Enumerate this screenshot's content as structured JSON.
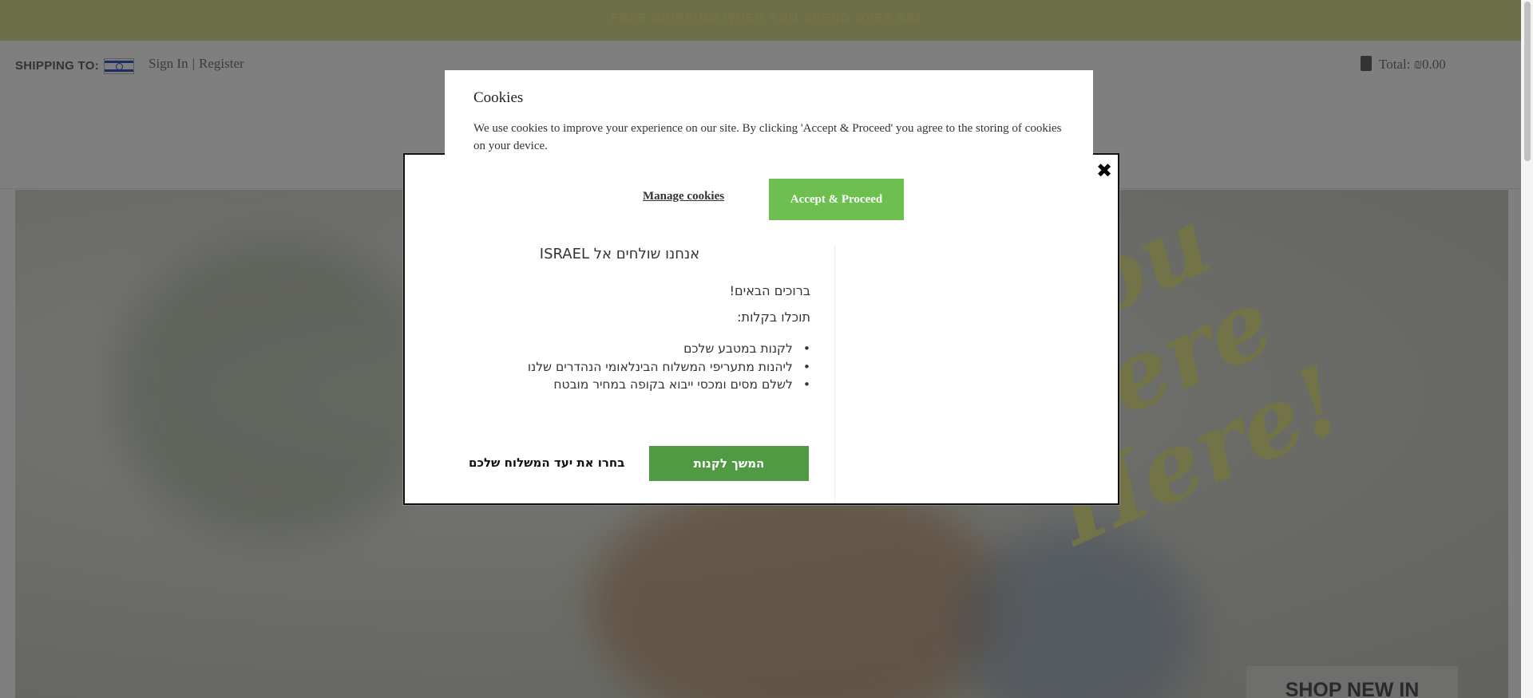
{
  "promo": {
    "text": "FREE SHIPPING WHEN YOU SPEND OVER $99"
  },
  "header": {
    "shipping_label": "SHIPPING TO:",
    "sign_in": "Sign In",
    "separator": "|",
    "register": "Register",
    "cart_total": "Total: ₪0.00"
  },
  "hero": {
    "line1": "h You",
    "line2": "Were Here!",
    "shop_new_in": "SHOP NEW IN"
  },
  "shipping_modal": {
    "title": "אנחנו שולחים אל ISRAEL",
    "welcome": "ברוכים הבאים!",
    "you_can": "תוכלו בקלות:",
    "benefits": [
      "לקנות במטבע שלכם",
      "ליהנות מתעריפי המשלוח הבינלאומי הנהדרים שלנו",
      "לשלם מסים ומכסי ייבוא בקופה במחיר מובטח"
    ],
    "continue_label": "המשך לקנות",
    "choose_destination_label": "בחרו את יעד המשלוח שלכם",
    "close_icon": "close-icon"
  },
  "cookie_modal": {
    "title": "Cookies",
    "text": "We use cookies to improve your experience on our site. By clicking 'Accept & Proceed' you agree to the storing of cookies on your device.",
    "manage_label": "Manage cookies",
    "accept_label": "Accept & Proceed"
  },
  "colors": {
    "promo_bg": "#d9de8f",
    "continue_green": "#4f9a43",
    "accept_green": "#6dc04f"
  }
}
